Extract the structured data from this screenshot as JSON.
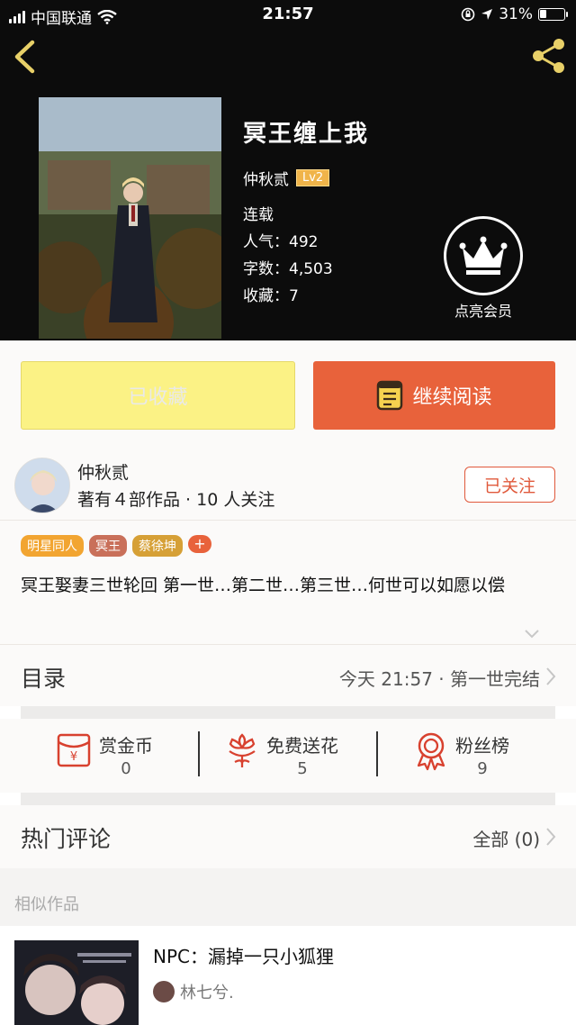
{
  "status_bar": {
    "carrier": "中国联通",
    "time": "21:57",
    "battery": "31%",
    "battery_level": 0.31
  },
  "book": {
    "title": "冥王缠上我",
    "author": "仲秋贰",
    "level": "Lv2",
    "status": "连载",
    "popularity": "人气：492",
    "word_count": "字数：4,503",
    "favorites": "收藏：7"
  },
  "vip": {
    "label": "点亮会员"
  },
  "actions": {
    "collected_label": "已收藏",
    "read_label": "继续阅读"
  },
  "author_card": {
    "name": "仲秋贰",
    "stats": "著有４部作品 · 10 人关注",
    "follow_label": "已关注"
  },
  "tags": [
    {
      "label": "明星同人",
      "color": "#f2a531"
    },
    {
      "label": "冥王",
      "color": "#c9705a"
    },
    {
      "label": "蔡徐坤",
      "color": "#d6a036"
    }
  ],
  "tag_add": "+",
  "description": "冥王娶妻三世轮回 第一世…第二世…第三世…何世可以如愿以偿",
  "toc": {
    "title": "目录",
    "latest": "今天 21:57 · 第一世完结"
  },
  "stats": [
    {
      "label": "赏金币",
      "value": "0",
      "icon": "red-envelope-icon"
    },
    {
      "label": "免费送花",
      "value": "5",
      "icon": "flower-icon"
    },
    {
      "label": "粉丝榜",
      "value": "9",
      "icon": "medal-icon"
    }
  ],
  "comments": {
    "title": "热门评论",
    "all_label": "全部 (0)"
  },
  "similar": {
    "header": "相似作品",
    "items": [
      {
        "title": "NPC：漏掉一只小狐狸",
        "author": "林七兮."
      }
    ]
  },
  "colors": {
    "accent": "#e8623b",
    "collected_bg": "#fbf285",
    "level_badge": "#f0b44a",
    "back_arrow": "#e8d068"
  }
}
